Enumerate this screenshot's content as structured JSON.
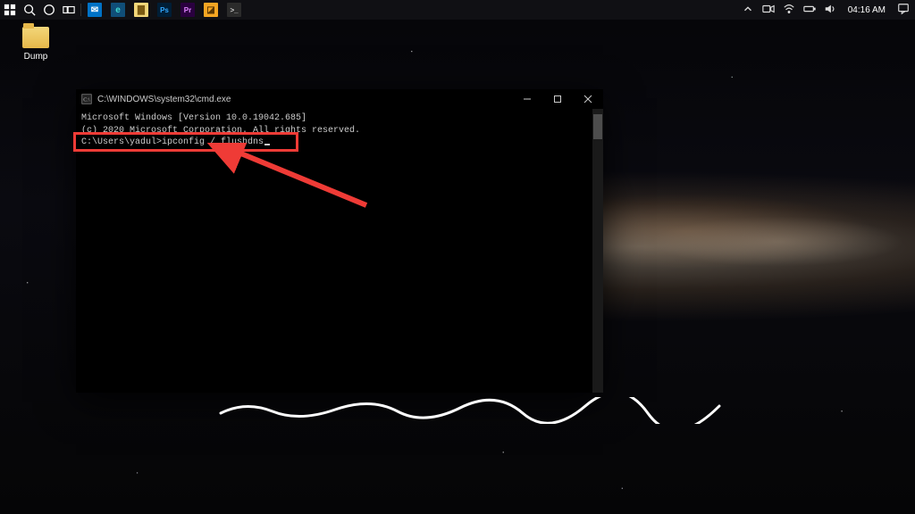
{
  "taskbar": {
    "left_items": [
      {
        "name": "start-button",
        "kind": "svg-windows"
      },
      {
        "name": "search-button",
        "kind": "svg-search"
      },
      {
        "name": "cortana-button",
        "kind": "svg-circle"
      },
      {
        "name": "task-view-button",
        "kind": "svg-taskview"
      },
      {
        "name": "divider",
        "kind": "divider"
      },
      {
        "name": "app-mail",
        "kind": "tile",
        "bg": "#0072c6",
        "fg": "#fff",
        "glyph": "✉"
      },
      {
        "name": "app-edge",
        "kind": "tile",
        "bg": "#1b5e8f",
        "fg": "#38d7c9",
        "glyph": "e"
      },
      {
        "name": "app-explorer",
        "kind": "tile",
        "bg": "#f3d77a",
        "fg": "#7a5a12",
        "glyph": "▇"
      },
      {
        "name": "app-photoshop",
        "kind": "tile",
        "bg": "#001e36",
        "fg": "#31a8ff",
        "glyph": "Ps"
      },
      {
        "name": "app-premiere",
        "kind": "tile",
        "bg": "#2a003f",
        "fg": "#e085ff",
        "glyph": "Pr"
      },
      {
        "name": "app-yellow",
        "kind": "tile",
        "bg": "#f5a623",
        "fg": "#5a3700",
        "glyph": "◪"
      },
      {
        "name": "app-cmd",
        "kind": "tile",
        "bg": "#2b2b2b",
        "fg": "#ccc",
        "glyph": ">_"
      }
    ],
    "tray": {
      "items": [
        {
          "name": "tray-chevron",
          "kind": "svg-chevron"
        },
        {
          "name": "tray-meet-now",
          "kind": "svg-video"
        },
        {
          "name": "tray-wifi",
          "kind": "svg-wifi"
        },
        {
          "name": "tray-battery",
          "kind": "svg-battery"
        },
        {
          "name": "tray-volume",
          "kind": "svg-volume"
        }
      ],
      "time": "04:16 AM",
      "action_center": {
        "name": "action-center",
        "kind": "svg-notification"
      }
    }
  },
  "desktop": {
    "icons": [
      {
        "name": "folder-dump",
        "label": "Dump"
      }
    ]
  },
  "cmd": {
    "title": "C:\\WINDOWS\\system32\\cmd.exe",
    "lines": {
      "version": "Microsoft Windows [Version 10.0.19042.685]",
      "copyright": "(c) 2020 Microsoft Corporation. All rights reserved.",
      "blank": "",
      "prompt": "C:\\Users\\yadul>ipconfig / flushdns"
    },
    "controls": {
      "minimize": "Minimize",
      "maximize": "Maximize",
      "close": "Close"
    }
  },
  "annotation": {
    "box": true,
    "arrow": true,
    "squiggle": true
  }
}
